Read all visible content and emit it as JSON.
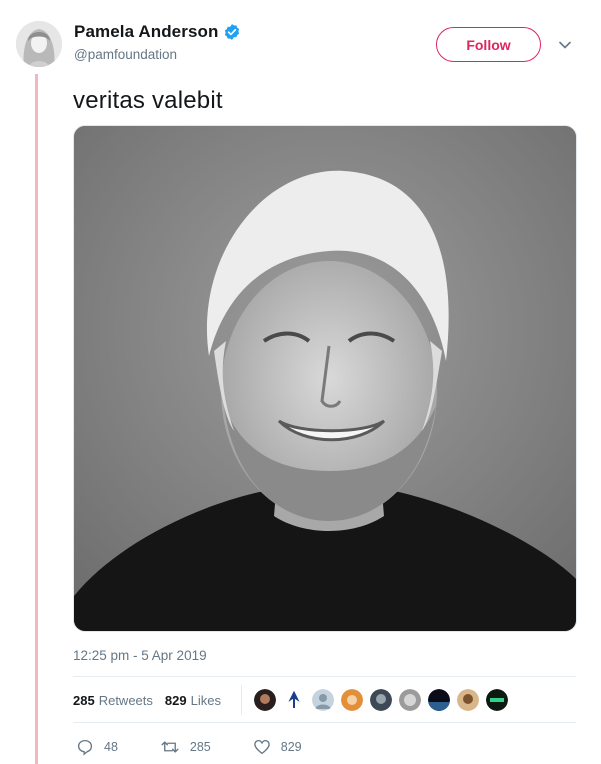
{
  "author": {
    "display_name": "Pamela Anderson",
    "handle": "@pamfoundation",
    "verified": true,
    "avatar_icon": "profile-photo"
  },
  "follow_button": {
    "label": "Follow",
    "color": "#e0245e"
  },
  "menu_icon": "chevron-down-icon",
  "tweet": {
    "text": "veritas valebit",
    "media_description": "black-and-white portrait photo",
    "timestamp": "12:25 pm - 5 Apr 2019"
  },
  "stats": {
    "retweets_count": "285",
    "retweets_label": "Retweets",
    "likes_count": "829",
    "likes_label": "Likes"
  },
  "likers": [
    {
      "icon": "liker-avatar-1"
    },
    {
      "icon": "liker-avatar-2"
    },
    {
      "icon": "liker-avatar-3"
    },
    {
      "icon": "liker-avatar-4"
    },
    {
      "icon": "liker-avatar-5"
    },
    {
      "icon": "liker-avatar-6"
    },
    {
      "icon": "liker-avatar-7"
    },
    {
      "icon": "liker-avatar-8"
    },
    {
      "icon": "liker-avatar-9"
    }
  ],
  "actions": {
    "reply_count": "48",
    "retweet_count": "285",
    "like_count": "829"
  },
  "colors": {
    "thread_line": "#f4b7bd",
    "secondary_text": "#657786",
    "verified_blue": "#1da1f2"
  }
}
